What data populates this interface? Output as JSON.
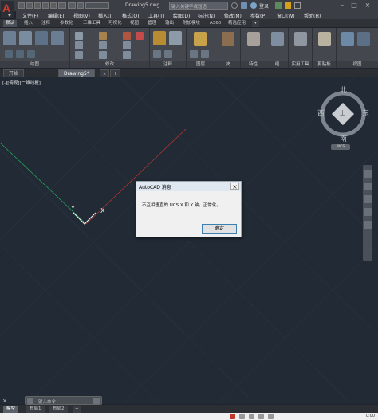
{
  "window": {
    "doc_title": "Drawing5.dwg",
    "search_placeholder": "键入关键字或短语",
    "login_label": "登录"
  },
  "menu": [
    "文件(F)",
    "编辑(E)",
    "视图(V)",
    "插入(I)",
    "格式(O)",
    "工具(T)",
    "绘图(D)",
    "标注(N)",
    "修改(M)",
    "参数(P)",
    "窗口(W)",
    "帮助(H)"
  ],
  "ribbon_tabs": [
    "默认",
    "插入",
    "注释",
    "参数化",
    "三维工具",
    "可视化",
    "视图",
    "管理",
    "输出",
    "附加模块",
    "A360",
    "精选应用"
  ],
  "ribbon_active_tab": "默认",
  "ribbon_panels": {
    "draw": "绘图",
    "modify": "修改",
    "annotate": "注释",
    "layers": "图层",
    "block": "块",
    "properties": "特性",
    "groups": "组",
    "utilities": "实用工具",
    "clipboard": "剪贴板",
    "view": "视图"
  },
  "file_tabs": [
    {
      "label": "开始",
      "active": false
    },
    {
      "label": "Drawing5*",
      "active": true
    }
  ],
  "viewport_label": "[-][俯视][二维线框]",
  "viewcube": {
    "north": "北",
    "south": "南",
    "east": "东",
    "west": "西",
    "face": "上",
    "wcs": "WCS"
  },
  "ucs": {
    "y_label": "Y",
    "x_label": "X"
  },
  "dialog": {
    "title": "AutoCAD 消息",
    "message": "不互相垂直的 UCS X 和 Y 轴。正常化。",
    "ok_label": "确定",
    "close_label": "×"
  },
  "command": {
    "placeholder": "键入命令"
  },
  "layout_tabs": [
    {
      "label": "模型",
      "active": true
    },
    {
      "label": "布局1",
      "active": false
    },
    {
      "label": "布局2",
      "active": false
    }
  ],
  "status": {
    "right_text": "0:00"
  },
  "colors": {
    "canvas": "#212a35",
    "ucs_x_axis": "#c0392b",
    "ucs_y_axis": "#27ae60",
    "accent": "#d23a2b"
  }
}
